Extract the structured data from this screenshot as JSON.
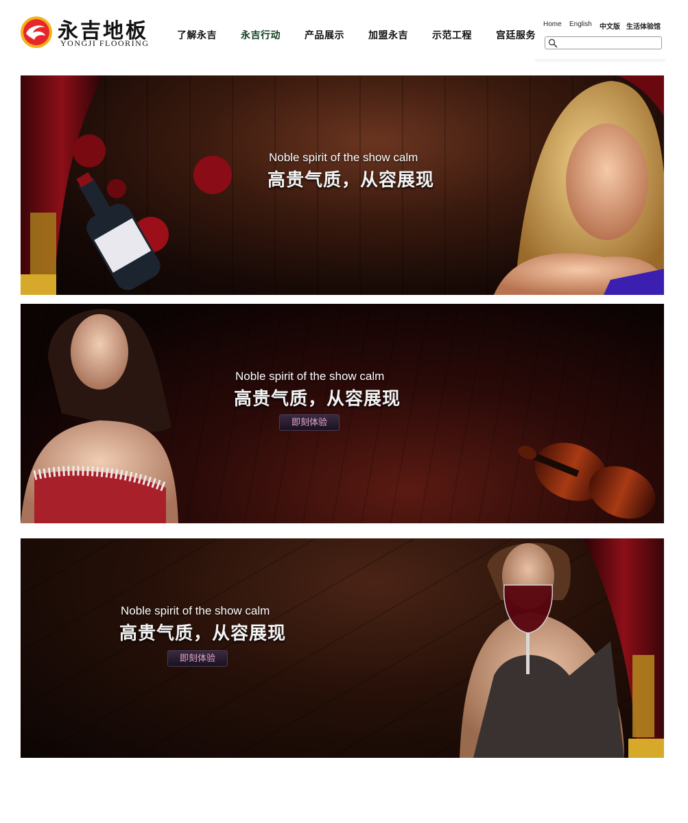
{
  "brand": {
    "name_cn": "永吉地板",
    "name_en": "YONGJI FLOORING",
    "logo_color": "#e8252b",
    "logo_ring_color": "#f2b21c"
  },
  "nav": {
    "items": [
      {
        "label": "了解永吉"
      },
      {
        "label": "永吉行动",
        "active": true
      },
      {
        "label": "产品展示"
      },
      {
        "label": "加盟永吉"
      },
      {
        "label": "示范工程"
      },
      {
        "label": "宫廷服务"
      }
    ]
  },
  "toplinks": {
    "home": "Home",
    "english": "English",
    "chinese": "中文版",
    "experience": "生活体验馆"
  },
  "search": {
    "placeholder": "",
    "icon": "search-icon"
  },
  "banners": [
    {
      "slogan_en": "Noble spirit of the show calm",
      "slogan_cn": "高贵气质，从容展现",
      "cta": ""
    },
    {
      "slogan_en": "Noble spirit of the show calm",
      "slogan_cn": "高贵气质，从容展现",
      "cta": "即刻体验"
    },
    {
      "slogan_en": "Noble spirit of the show calm",
      "slogan_cn": "高贵气质，从容展现",
      "cta": "即刻体验"
    }
  ]
}
